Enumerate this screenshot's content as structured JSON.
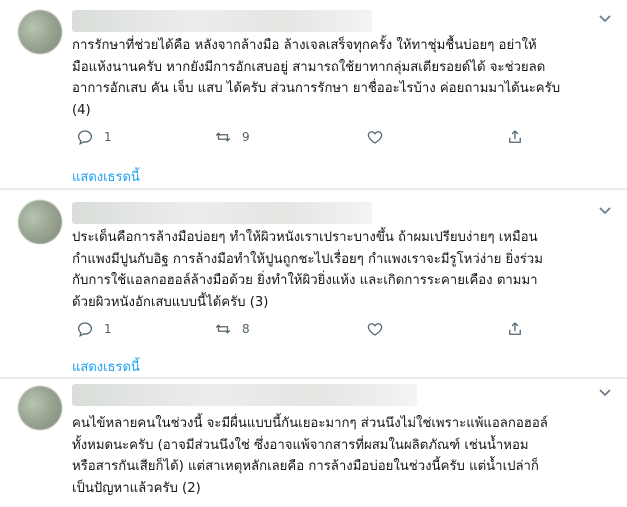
{
  "tweets": [
    {
      "text": "การรักษาที่ช่วยได้คือ หลังจากล้างมือ ล้างเจลเสร็จทุกครั้ง ให้ทาชุ่มชื้นบ่อยๆ อย่าให้\nมือแห้งนานครับ หากยังมีการอักเสบอยู่ สามารถใช้ยาทากลุ่มสเตียรอยด์ได้ จะช่วยลด\nอาการอักเสบ คัน เจ็บ แสบ ได้ครับ ส่วนการรักษา ยาชื่ออะไรบ้าง ค่อยถามมาได้นะครับ\n(4)",
      "reply_count": "1",
      "retweet_count": "9",
      "show_thread": "แสดงเธรดนี้"
    },
    {
      "text": "ประเด็นคือการล้างมือบ่อยๆ ทำให้ผิวหนังเราเปราะบางขึ้น ถ้าผมเปรียบง่ายๆ เหมือน\nกำแพงมีปูนกับอิฐ การล้างมือทำให้ปูนถูกชะไปเรื่อยๆ กำแพงเราจะมีรูโหว่ง่าย ยิ่งร่วม\nกับการใช้แอลกอฮอล์ล้างมือด้วย ยิ่งทำให้ผิวยิ่งแห้ง และเกิดการระคายเคือง ตามมา\nด้วยผิวหนังอักเสบแบบนี้ได้ครับ (3)",
      "reply_count": "1",
      "retweet_count": "8",
      "show_thread": "แสดงเธรดนี้"
    },
    {
      "text": "คนไข้หลายคนในช่วงนี้ จะมีผื่นแบบนี้กันเยอะมากๆ ส่วนนึงไม่ใช่เพราะแพ้แอลกอฮอล์\nทั้งหมดนะครับ (อาจมีส่วนนึงใช่ ซึ่งอาจแพ้จากสารที่ผสมในผลิตภัณฑ์ เช่นน้ำหอม\nหรือสารกันเสียก็ได้) แต่สาเหตุหลักเลยคือ การล้างมือบ่อยในช่วงนี้ครับ แต่น้ำเปล่าก็\nเป็นปัญหาแล้วครับ (2)"
    }
  ]
}
